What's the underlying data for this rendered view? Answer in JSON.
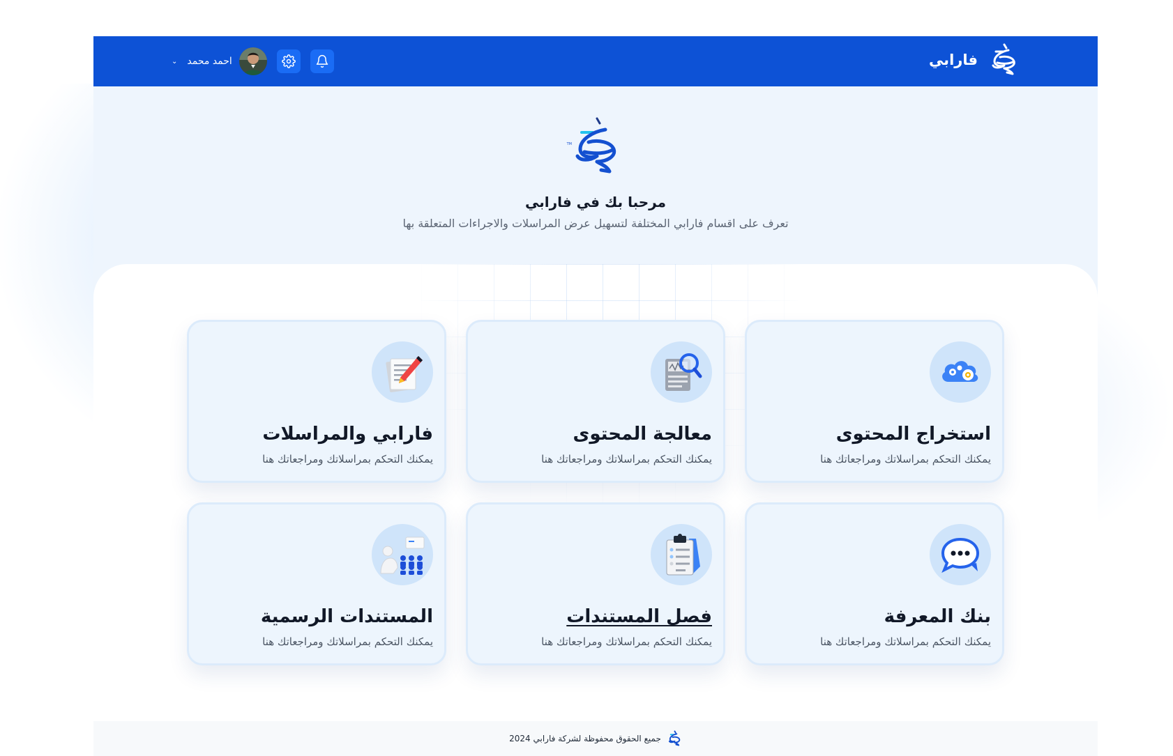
{
  "header": {
    "brand_name": "فارابي",
    "user_name": "احمد محمد"
  },
  "hero": {
    "title": "مرحبا بك في فارابي",
    "subtitle": "تعرف على اقسام فارابي المختلفة لتسهيل عرض المراسلات والاجراءات المتعلقة بها"
  },
  "cards": [
    {
      "title": "استخراج المحتوى",
      "description": "يمكنك التحكم بمراسلاتك ومراجعاتك هنا",
      "icon": "cloud-gear-icon"
    },
    {
      "title": "معالجة المحتوى",
      "description": "يمكنك التحكم بمراسلاتك ومراجعاتك هنا",
      "icon": "document-search-icon"
    },
    {
      "title": "فارابي والمراسلات",
      "description": "يمكنك التحكم بمراسلاتك ومراجعاتك هنا",
      "icon": "document-pencil-icon"
    },
    {
      "title": "بنك المعرفة",
      "description": "يمكنك التحكم بمراسلاتك ومراجعاتك هنا",
      "icon": "chat-bubble-icon"
    },
    {
      "title": "فصل المستندات",
      "description": "يمكنك التحكم بمراسلاتك ومراجعاتك هنا",
      "icon": "clipboard-checklist-icon"
    },
    {
      "title": "المستندات الرسمية",
      "description": "يمكنك التحكم بمراسلاتك ومراجعاتك هنا",
      "icon": "presentation-people-icon"
    }
  ],
  "footer": {
    "text": "جميع الحقوق محفوظة لشركة فارابي 2024"
  },
  "colors": {
    "primary": "#0d52d6",
    "button": "#1a6cf5",
    "card_bg": "#edf5fd",
    "hero_bg": "#eef5fd"
  }
}
